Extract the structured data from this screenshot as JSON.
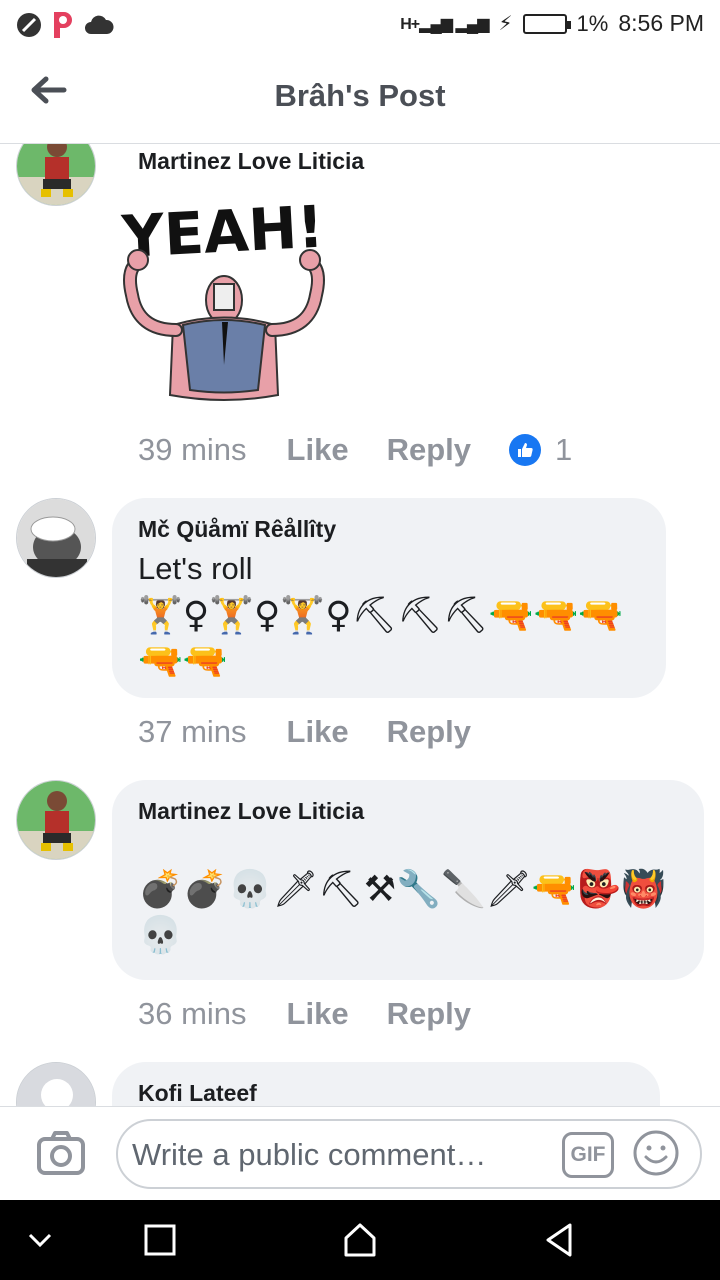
{
  "status_bar": {
    "signal": "H+",
    "battery": "1%",
    "time": "8:56 PM"
  },
  "header": {
    "title": "Brâh's Post"
  },
  "comments": [
    {
      "author": "Martinez Love Liticia",
      "sticker_text": "YEAH!",
      "time": "39 mins",
      "like_label": "Like",
      "reply_label": "Reply",
      "reaction_count": "1"
    },
    {
      "author": "Mč Qüåmï Rêållîty",
      "text": "Let's roll",
      "emoji": "🏋♀🏋♀🏋♀⛏⛏⛏🔫🔫🔫🔫🔫",
      "time": "37 mins",
      "like_label": "Like",
      "reply_label": "Reply"
    },
    {
      "author": "Martinez Love Liticia",
      "emoji": "💣💣💀🗡⛏⚒🔧🔪🗡🔫👺👹💀",
      "time": "36 mins",
      "like_label": "Like",
      "reply_label": "Reply"
    },
    {
      "author": "Kofi Lateef"
    }
  ],
  "composer": {
    "placeholder": "Write a public comment…",
    "gif_label": "GIF"
  },
  "colors": {
    "accent": "#1877f2",
    "bubble": "#f0f2f5",
    "muted": "#90949c"
  }
}
